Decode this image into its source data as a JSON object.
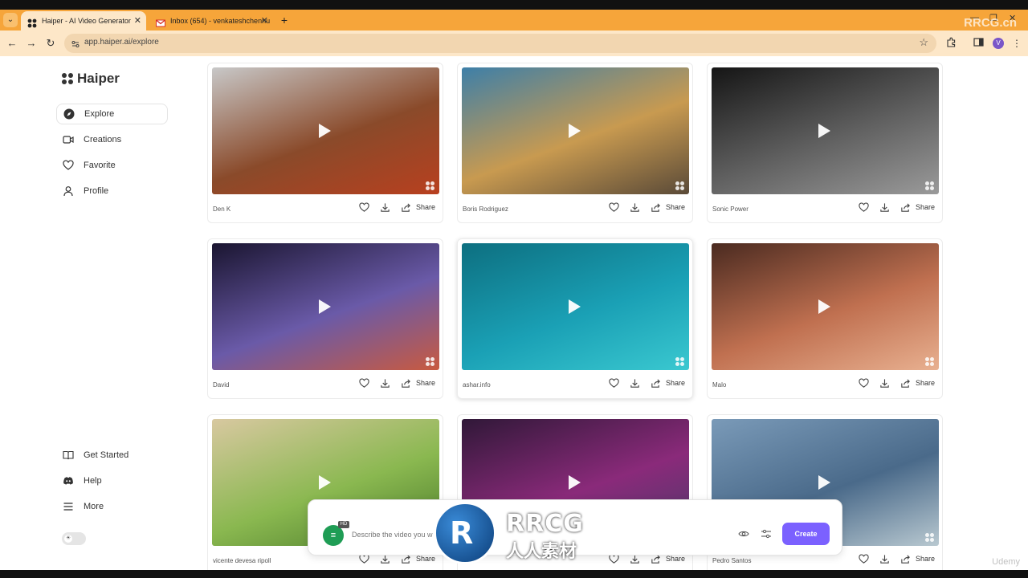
{
  "browser": {
    "tabs": [
      {
        "title": "Haiper - AI Video Generator",
        "active": true
      },
      {
        "title": "Inbox (654) - venkateshchennu",
        "active": false
      }
    ],
    "url": "app.haiper.ai/explore",
    "avatar_letter": "V",
    "corner_watermark": "RRCG.cn"
  },
  "sidebar": {
    "logo": "Haiper",
    "items": [
      {
        "label": "Explore",
        "icon": "compass-icon"
      },
      {
        "label": "Creations",
        "icon": "video-icon"
      },
      {
        "label": "Favorite",
        "icon": "heart-icon"
      },
      {
        "label": "Profile",
        "icon": "user-icon"
      }
    ],
    "bottom_items": [
      {
        "label": "Get Started",
        "icon": "book-icon"
      },
      {
        "label": "Help",
        "icon": "discord-icon"
      },
      {
        "label": "More",
        "icon": "menu-icon"
      }
    ]
  },
  "cards": [
    {
      "creator": "Den K",
      "share_label": "Share",
      "colors": [
        "#c8c8c8",
        "#8a4a2a",
        "#b8401f"
      ]
    },
    {
      "creator": "Boris Rodriguez",
      "share_label": "Share",
      "colors": [
        "#3d7fa8",
        "#c89a50",
        "#5a4a38"
      ]
    },
    {
      "creator": "Sonic Power",
      "share_label": "Share",
      "colors": [
        "#151515",
        "#606060",
        "#9a9a9a"
      ]
    },
    {
      "creator": "David",
      "share_label": "Share",
      "colors": [
        "#1a1530",
        "#6a5aa8",
        "#c85a40"
      ]
    },
    {
      "creator": "ashar.info",
      "share_label": "Share",
      "colors": [
        "#0d6f80",
        "#1aa0b5",
        "#3ac8d0"
      ]
    },
    {
      "creator": "Malo",
      "share_label": "Share",
      "colors": [
        "#4a2a20",
        "#c07050",
        "#e8b090"
      ]
    },
    {
      "creator": "vicente devesa ripoll",
      "share_label": "Share",
      "colors": [
        "#d8c8a0",
        "#8ab850",
        "#4a7a2a"
      ]
    },
    {
      "creator": "",
      "share_label": "Share",
      "colors": [
        "#301838",
        "#8a2a7a",
        "#4a3a6a"
      ]
    },
    {
      "creator": "Pedro Santos",
      "share_label": "Share",
      "colors": [
        "#7a9ab8",
        "#4a6a8a",
        "#b8c8d0"
      ]
    }
  ],
  "prompt": {
    "placeholder": "Describe the video you w",
    "hd_badge": "HD",
    "create_label": "Create"
  },
  "overlay": {
    "logo_letter": "R",
    "title": "RRCG",
    "subtitle": "人人素材",
    "platform": "Udemy"
  }
}
